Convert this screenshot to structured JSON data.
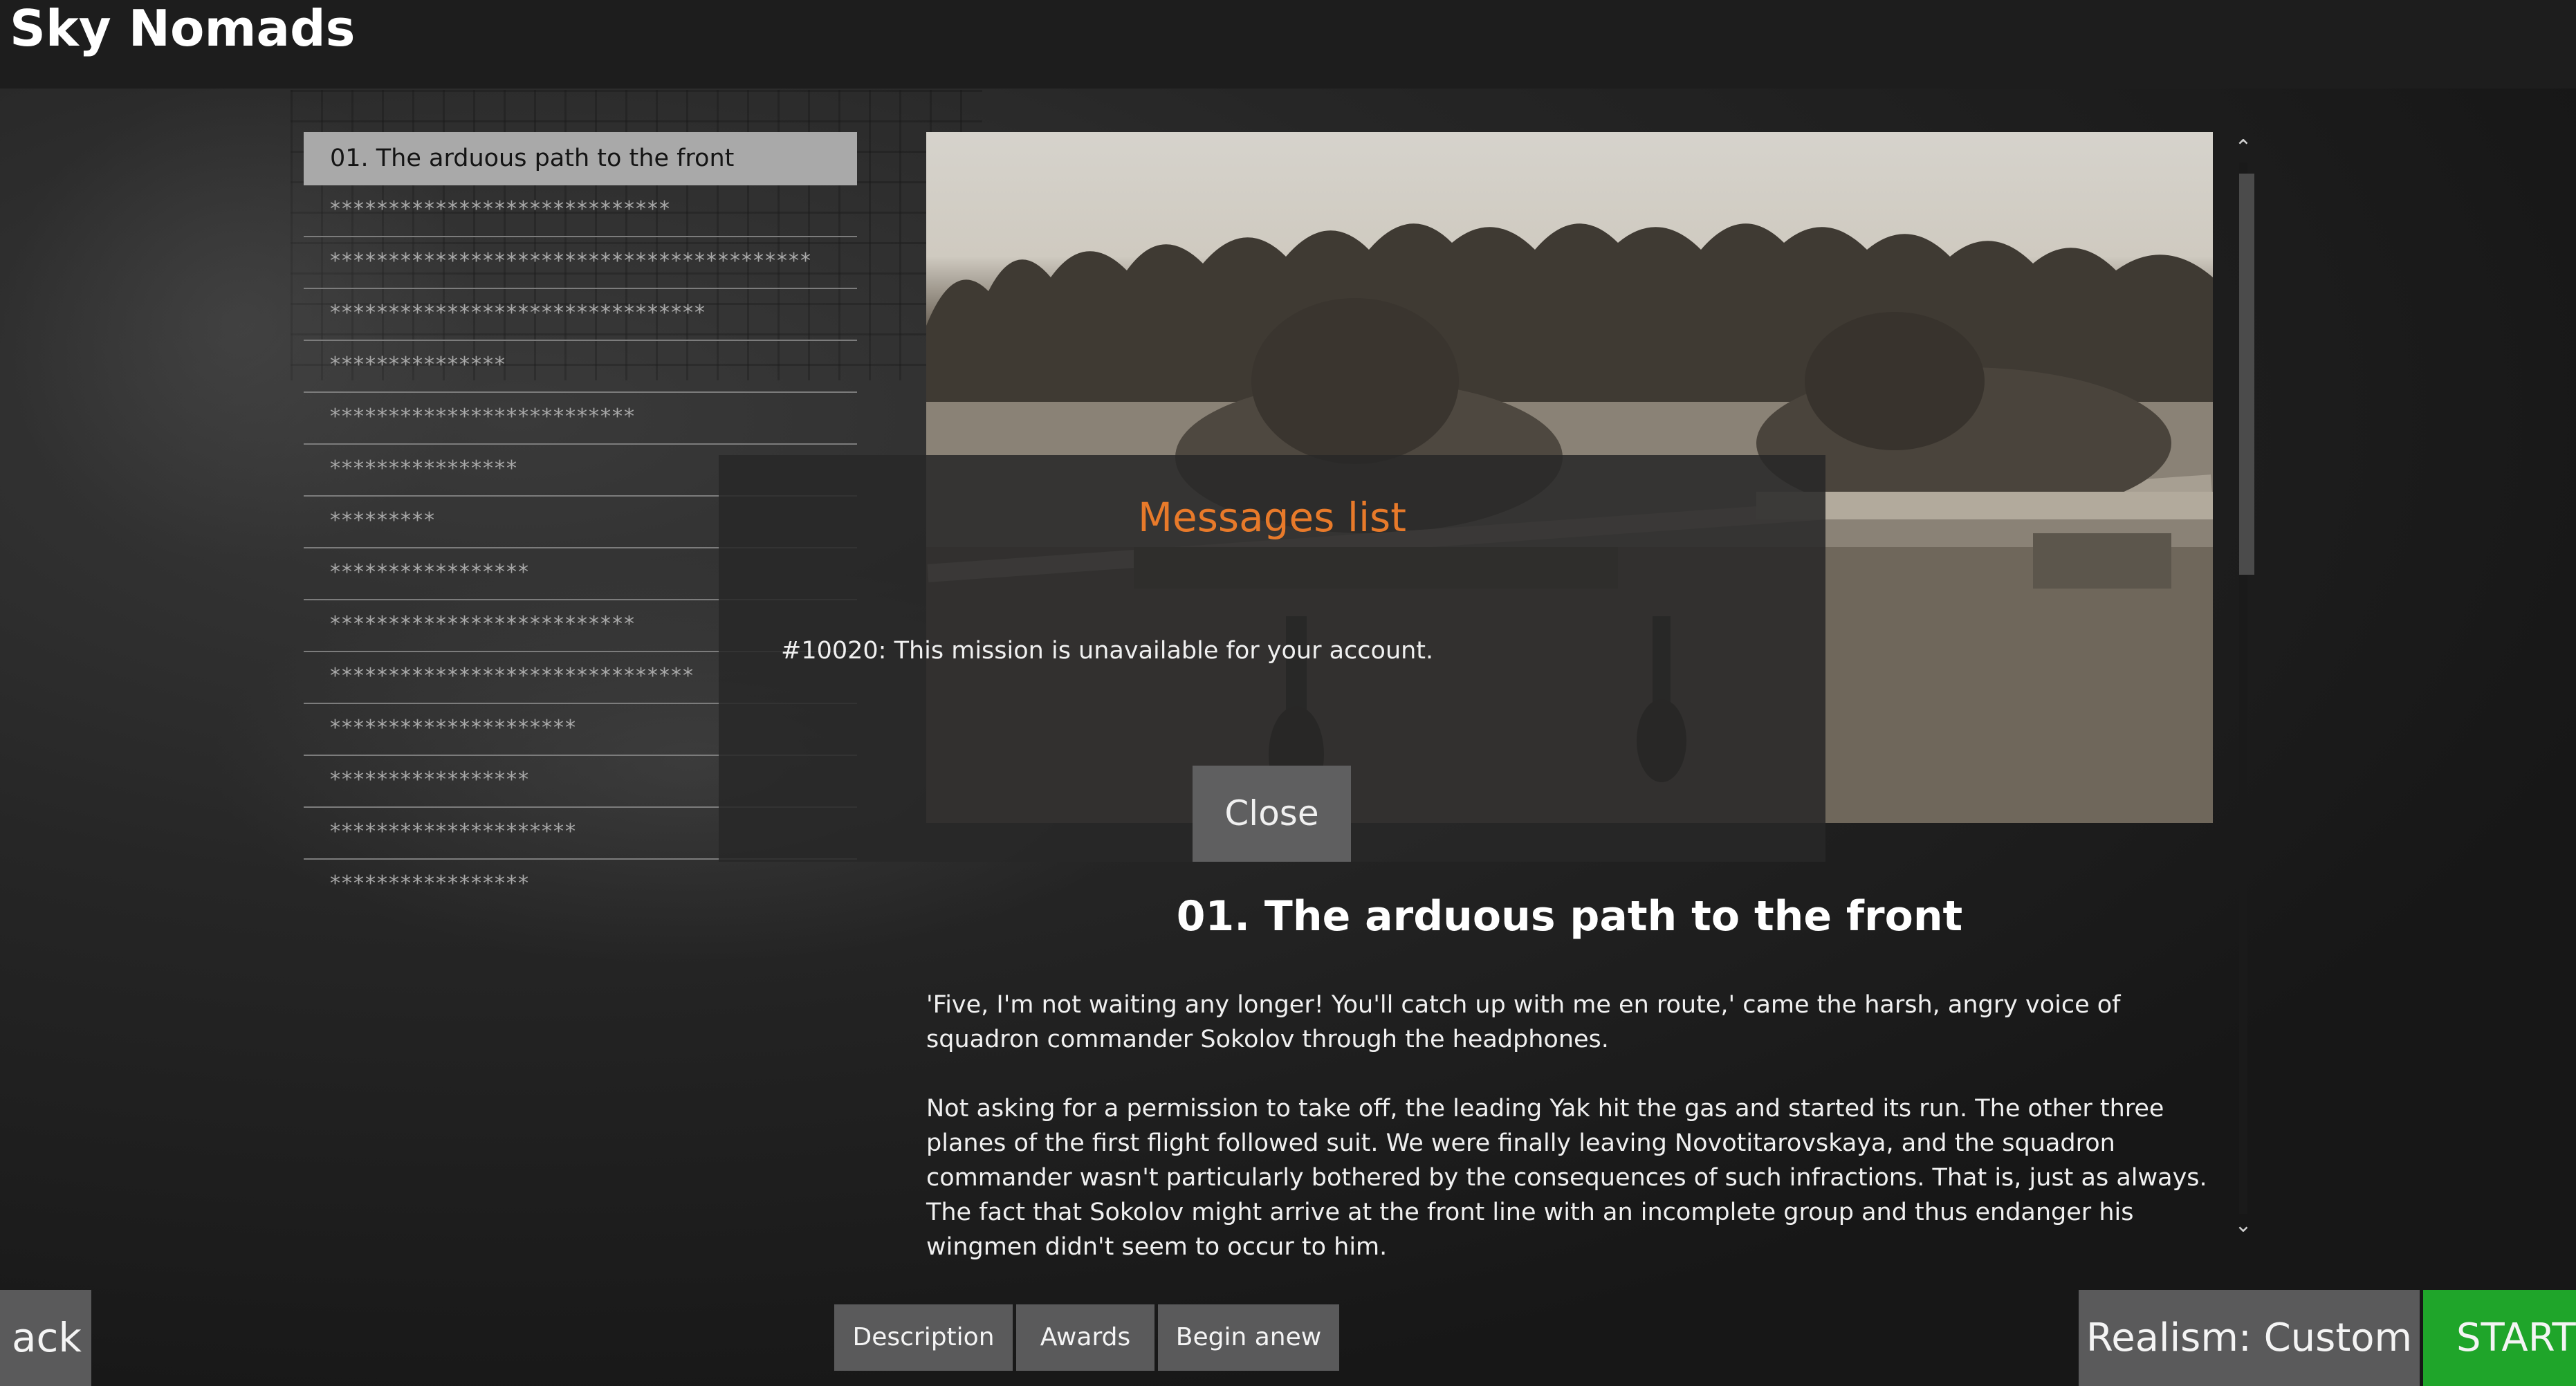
{
  "app": {
    "title": "Sky Nomads"
  },
  "missions": [
    {
      "label": "01. The arduous path to the front",
      "selected": true
    },
    {
      "label": "*****************************"
    },
    {
      "label": "*****************************************"
    },
    {
      "label": "********************************"
    },
    {
      "label": "***************"
    },
    {
      "label": "**************************"
    },
    {
      "label": "****************"
    },
    {
      "label": "*********"
    },
    {
      "label": "*****************"
    },
    {
      "label": "**************************"
    },
    {
      "label": "*******************************"
    },
    {
      "label": "*********************"
    },
    {
      "label": "*****************"
    },
    {
      "label": "*********************"
    },
    {
      "label": "*****************"
    }
  ],
  "briefing": {
    "title": "01. The arduous path to the front",
    "paragraphs": [
      "'Five, I'm not waiting any longer! You'll catch up with me en route,' came the harsh, angry voice of squadron commander Sokolov through the headphones.",
      "Not asking for a permission to take off, the leading Yak hit the gas and started its run. The other three planes of the first flight followed suit. We were finally leaving Novotitarovskaya, and the squadron commander wasn't particularly bothered by the consequences of such infractions. That is, just as always. The fact that Sokolov might arrive at the front line with an incomplete group and thus endanger his wingmen didn't seem to occur to him."
    ]
  },
  "modal": {
    "title": "Messages list",
    "message": "#10020: This mission is unavailable for your account.",
    "close_label": "Close"
  },
  "buttons": {
    "back": "ack",
    "description": "Description",
    "awards": "Awards",
    "begin_anew": "Begin anew",
    "realism": "Realism: Custom",
    "start": "START"
  },
  "icons": {
    "scroll_up": "chevron-up-icon",
    "scroll_down": "chevron-down-icon"
  },
  "colors": {
    "accent_orange": "#e87a2a",
    "start_green": "#1fa52a",
    "button_gray": "#5a5a5b",
    "selected_item": "#a9a9a9"
  }
}
